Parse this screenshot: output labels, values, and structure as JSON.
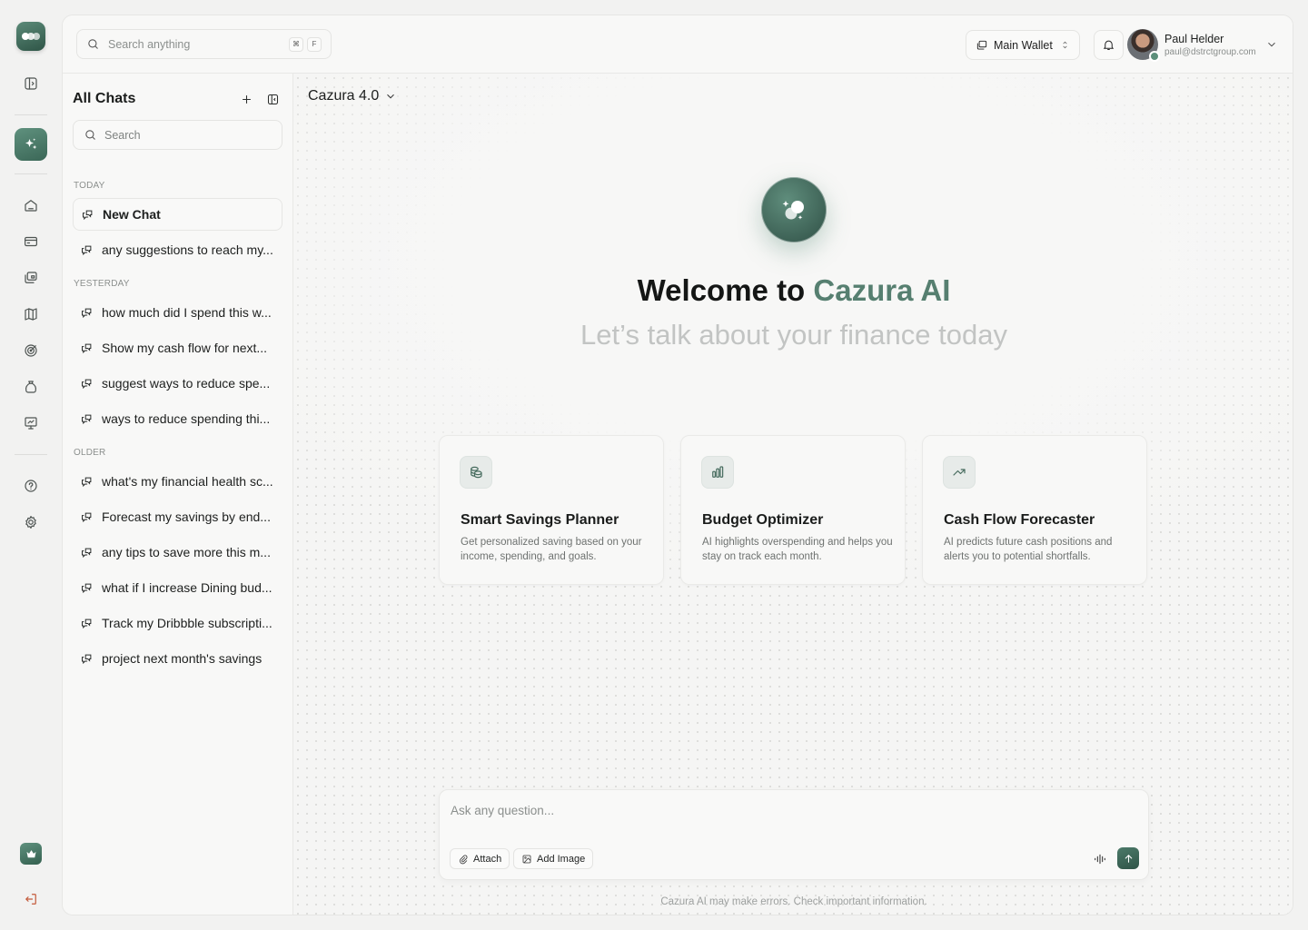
{
  "colors": {
    "accent": "#567f70",
    "brand_dark": "#2f5547",
    "logout": "#c45a3a"
  },
  "rail": {
    "icons": [
      "logo-icon",
      "panel-toggle-icon",
      "ai-sparkle-icon",
      "home-icon",
      "card-icon",
      "wallet-icon",
      "map-icon",
      "target-icon",
      "bag-icon",
      "presentation-icon",
      "help-icon",
      "settings-icon",
      "crown-icon",
      "logout-icon"
    ]
  },
  "topbar": {
    "search_placeholder": "Search anything",
    "shortcut_cmd": "⌘",
    "shortcut_key": "F",
    "wallet_label": "Main Wallet",
    "user_name": "Paul Helder",
    "user_email": "paul@dstrctgroup.com"
  },
  "chats": {
    "title": "All Chats",
    "search_placeholder": "Search",
    "groups": [
      {
        "label": "TODAY",
        "items": [
          "New Chat",
          "any suggestions to reach my..."
        ]
      },
      {
        "label": "YESTERDAY",
        "items": [
          "how much did I spend this w...",
          "Show my cash flow for next...",
          "suggest ways to reduce spe...",
          "ways to reduce spending thi..."
        ]
      },
      {
        "label": "OLDER",
        "items": [
          "what's my financial health sc...",
          "Forecast my savings by end...",
          "any tips to save more this m...",
          "what if I increase Dining bud...",
          "Track my Dribbble subscripti...",
          "project next month's savings"
        ]
      }
    ]
  },
  "main": {
    "model": "Cazura 4.0",
    "welcome_prefix": "Welcome to",
    "welcome_accent": "Cazura AI",
    "subtitle": "Let’s talk about your finance today",
    "cards": [
      {
        "icon": "coins-icon",
        "title": "Smart Savings Planner",
        "desc": "Get personalized saving based on your income, spending, and goals."
      },
      {
        "icon": "bar-chart-icon",
        "title": "Budget Optimizer",
        "desc": "AI highlights overspending and helps you stay on track each month."
      },
      {
        "icon": "trend-up-icon",
        "title": "Cash Flow Forecaster",
        "desc": "AI predicts future cash positions and alerts you to potential shortfalls."
      }
    ],
    "composer": {
      "placeholder": "Ask any question...",
      "attach_label": "Attach",
      "image_label": "Add Image"
    },
    "disclaimer": "Cazura AI may make errors. Check important information."
  }
}
